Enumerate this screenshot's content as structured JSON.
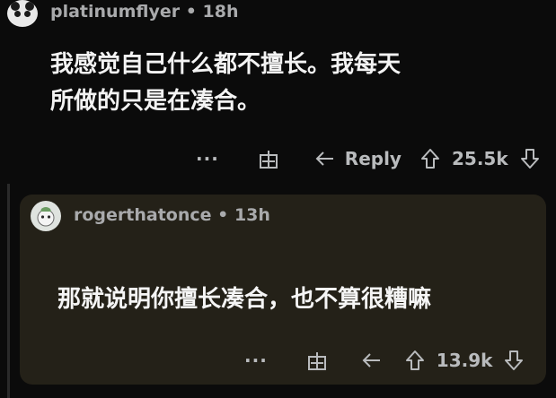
{
  "top_comment": {
    "username": "platinumflyer",
    "time": "18h",
    "text_line1": "我感觉自己什么都不擅长。我每天",
    "text_line2": "所做的只是在凑合。",
    "more_label": "···",
    "reply_label": "Reply",
    "upvotes": "25.5k"
  },
  "reply_comment": {
    "username": "rogerthatonce",
    "time": "13h",
    "text": "那就说明你擅长凑合，也不算很糟嘛",
    "more_label": "···",
    "upvotes": "13.9k"
  },
  "separator": "•"
}
